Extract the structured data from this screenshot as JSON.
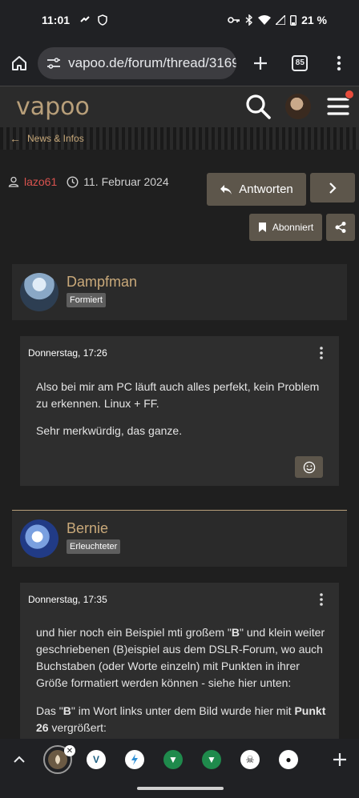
{
  "status": {
    "time": "11:01",
    "battery": "21 %"
  },
  "browser": {
    "url": "vapoo.de/forum/thread/3169",
    "tab_count": "85"
  },
  "site": {
    "logo": "vapoo"
  },
  "breadcrumb": {
    "label": "News & Infos"
  },
  "thread": {
    "author": "lazo61",
    "date": "11. Februar 2024",
    "reply_label": "Antworten",
    "subscribed_label": "Abonniert"
  },
  "posts": [
    {
      "user": "Dampfman",
      "rank": "Formiert",
      "date": "Donnerstag, 17:26",
      "paragraphs": [
        "Also bei mir am PC läuft auch alles perfekt, kein Problem zu erkennen. Linux + FF.",
        "Sehr merkwürdig, das ganze."
      ]
    },
    {
      "user": "Bernie",
      "rank": "Erleuchteter",
      "date": "Donnerstag, 17:35",
      "paragraphs": [
        "und hier noch ein Beispiel mti großem \"B\" und klein weiter geschriebenen (B)eispiel aus dem DSLR-Forum, wo auch Buchstaben (oder Worte einzeln) mit Punkten in ihrer Größe formatiert werden können - siehe hier unten:",
        "Das \"B\" im Wort links unter dem Bild wurde hier mit Punkt 26 vergrößert:"
      ]
    }
  ],
  "tabstrip": {
    "tabs": [
      {
        "icon": "vapoo-favicon",
        "color": "#b89f7a"
      },
      {
        "icon": "v-favicon",
        "color": "#2a7fa8"
      },
      {
        "icon": "bolt-favicon",
        "color": "#3aa0e0"
      },
      {
        "icon": "shield-favicon",
        "color": "#1f8a4c"
      },
      {
        "icon": "shield-favicon",
        "color": "#1f8a4c"
      },
      {
        "icon": "skull-favicon",
        "color": "#ffffff"
      },
      {
        "icon": "globe-favicon",
        "color": "#ffffff"
      }
    ]
  }
}
